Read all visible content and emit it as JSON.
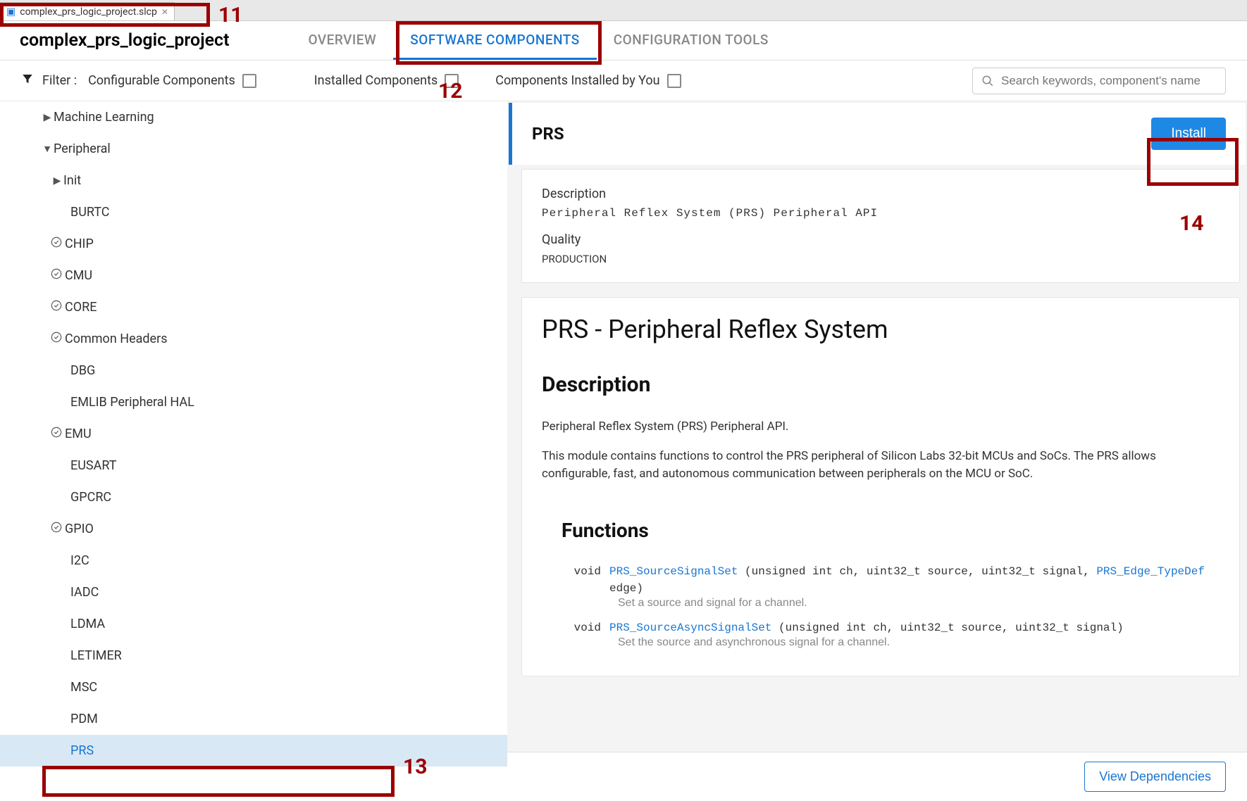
{
  "file_tab": {
    "name": "complex_prs_logic_project.slcp"
  },
  "project_title": "complex_prs_logic_project",
  "nav_tabs": {
    "overview": "OVERVIEW",
    "software": "SOFTWARE COMPONENTS",
    "config": "CONFIGURATION TOOLS"
  },
  "filter": {
    "label": "Filter :",
    "configurable": "Configurable Components",
    "installed": "Installed Components",
    "by_you": "Components Installed by You"
  },
  "search": {
    "placeholder": "Search keywords, component's name"
  },
  "tree": [
    {
      "label": "Machine Learning",
      "depth": 0,
      "caret": "right",
      "check": false
    },
    {
      "label": "Peripheral",
      "depth": 0,
      "caret": "down",
      "check": false
    },
    {
      "label": "Init",
      "depth": 1,
      "caret": "right",
      "check": false
    },
    {
      "label": "BURTC",
      "depth": 2,
      "caret": "",
      "check": false
    },
    {
      "label": "CHIP",
      "depth": 1,
      "caret": "",
      "check": true
    },
    {
      "label": "CMU",
      "depth": 1,
      "caret": "",
      "check": true
    },
    {
      "label": "CORE",
      "depth": 1,
      "caret": "",
      "check": true
    },
    {
      "label": "Common Headers",
      "depth": 1,
      "caret": "",
      "check": true
    },
    {
      "label": "DBG",
      "depth": 2,
      "caret": "",
      "check": false
    },
    {
      "label": "EMLIB Peripheral HAL",
      "depth": 2,
      "caret": "",
      "check": false
    },
    {
      "label": "EMU",
      "depth": 1,
      "caret": "",
      "check": true
    },
    {
      "label": "EUSART",
      "depth": 2,
      "caret": "",
      "check": false
    },
    {
      "label": "GPCRC",
      "depth": 2,
      "caret": "",
      "check": false
    },
    {
      "label": "GPIO",
      "depth": 1,
      "caret": "",
      "check": true
    },
    {
      "label": "I2C",
      "depth": 2,
      "caret": "",
      "check": false
    },
    {
      "label": "IADC",
      "depth": 2,
      "caret": "",
      "check": false
    },
    {
      "label": "LDMA",
      "depth": 2,
      "caret": "",
      "check": false
    },
    {
      "label": "LETIMER",
      "depth": 2,
      "caret": "",
      "check": false
    },
    {
      "label": "MSC",
      "depth": 2,
      "caret": "",
      "check": false
    },
    {
      "label": "PDM",
      "depth": 2,
      "caret": "",
      "check": false
    },
    {
      "label": "PRS",
      "depth": 2,
      "caret": "",
      "check": false,
      "selected": true
    }
  ],
  "detail": {
    "title": "PRS",
    "install": "Install",
    "desc_label": "Description",
    "desc_text": "Peripheral Reflex System (PRS) Peripheral API",
    "quality_label": "Quality",
    "quality_value": "PRODUCTION",
    "doc_title": "PRS - Peripheral Reflex System",
    "doc_h2": "Description",
    "doc_p1": "Peripheral Reflex System (PRS) Peripheral API.",
    "doc_p2": "This module contains functions to control the PRS peripheral of Silicon Labs 32-bit MCUs and SoCs. The PRS allows configurable, fast, and autonomous communication between peripherals on the MCU or SoC.",
    "functions_h": "Functions",
    "fn1": {
      "ret": "void",
      "name": "PRS_SourceSignalSet",
      "args_pre": " (unsigned int ch, uint32_t source, uint32_t signal, ",
      "type": "PRS_Edge_TypeDef",
      "args_post": " edge)",
      "desc": "Set a source and signal for a channel."
    },
    "fn2": {
      "ret": "void",
      "name": "PRS_SourceAsyncSignalSet",
      "args": " (unsigned int ch, uint32_t source, uint32_t signal)",
      "desc": "Set the source and asynchronous signal for a channel."
    }
  },
  "footer": {
    "deps": "View Dependencies"
  },
  "annotations": {
    "a11": "11",
    "a12": "12",
    "a13": "13",
    "a14": "14"
  }
}
